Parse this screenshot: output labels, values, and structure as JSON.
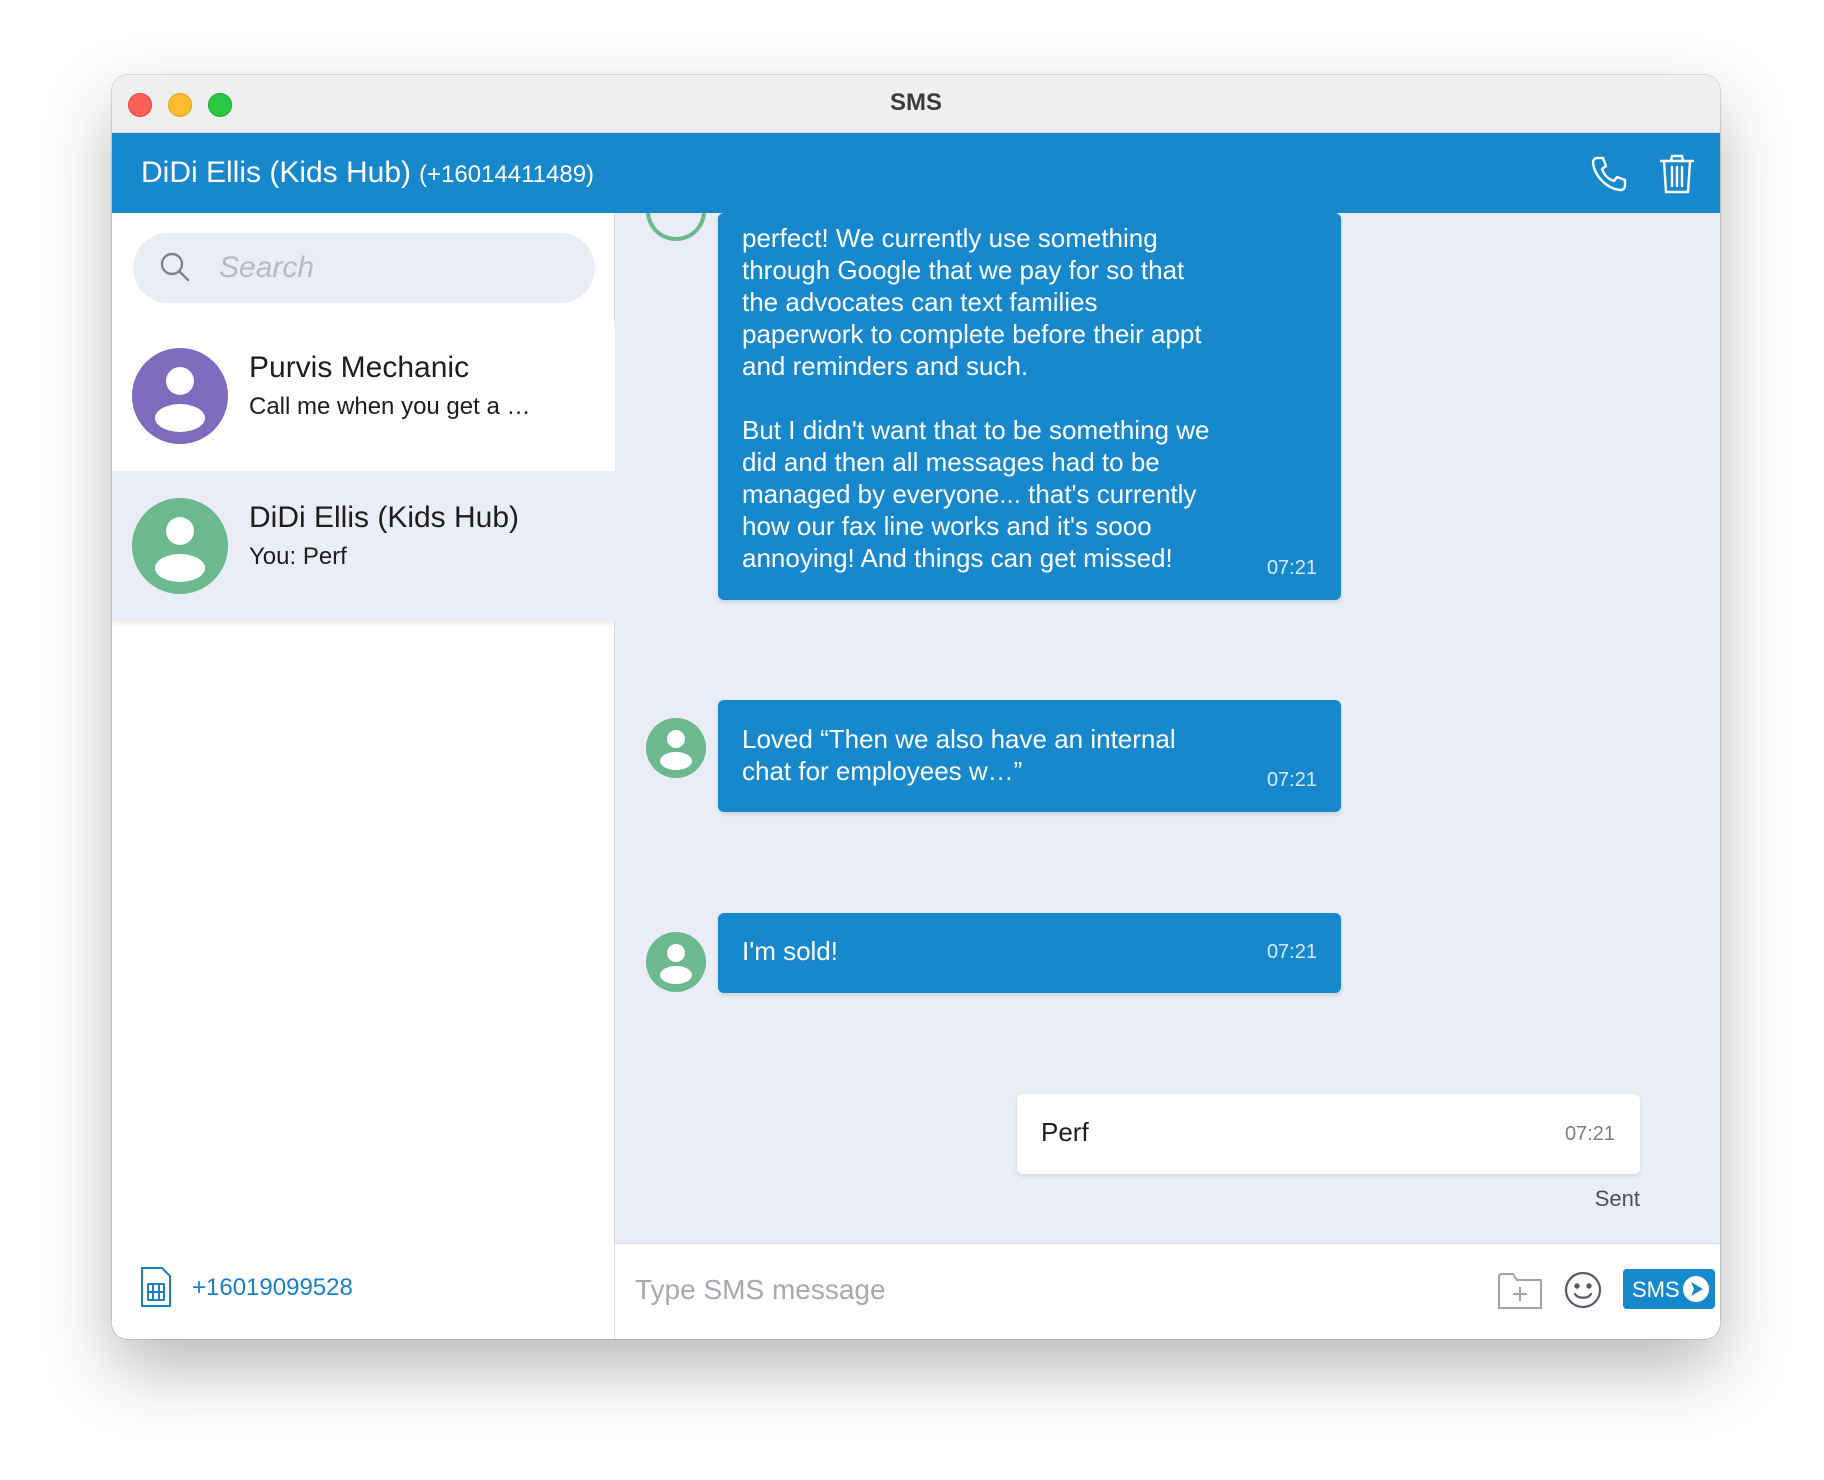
{
  "window": {
    "title": "SMS"
  },
  "header": {
    "contact_name": "DiDi Ellis (Kids Hub)",
    "contact_phone": "(+16014411489)",
    "call_icon": "phone-icon",
    "delete_icon": "trash-icon"
  },
  "sidebar": {
    "search_placeholder": "Search",
    "conversations": [
      {
        "name": "Purvis Mechanic",
        "preview": "Call me when you get a …",
        "avatar_color": "#7e6bbd",
        "selected": false
      },
      {
        "name": "DiDi Ellis (Kids Hub)",
        "preview": "You: Perf",
        "avatar_color": "#6cb98f",
        "selected": true
      }
    ],
    "sim_number": "+16019099528"
  },
  "messages": [
    {
      "direction": "incoming",
      "text": "perfect! We currently use something\nthrough Google that we pay for so that\nthe advocates can text families\npaperwork to complete before their appt\nand reminders and such.\n\nBut I didn't want that to be something we\ndid and then all messages had to be\nmanaged by everyone... that's currently\nhow our fax line works and it's sooo\nannoying! And things can get missed!",
      "time": "07:21"
    },
    {
      "direction": "incoming",
      "text": "Loved “Then we also have an internal\nchat for employees w…”",
      "time": "07:21"
    },
    {
      "direction": "incoming",
      "text": "I'm sold!",
      "time": "07:21"
    },
    {
      "direction": "outgoing",
      "text": "Perf",
      "time": "07:21",
      "status": "Sent"
    }
  ],
  "composer": {
    "placeholder": "Type SMS message",
    "send_label": "SMS"
  },
  "colors": {
    "accent": "#1788cb",
    "chat_background": "#eaedf5",
    "incoming_avatar": "#6cb98f",
    "purple_avatar": "#7e6bbd"
  }
}
